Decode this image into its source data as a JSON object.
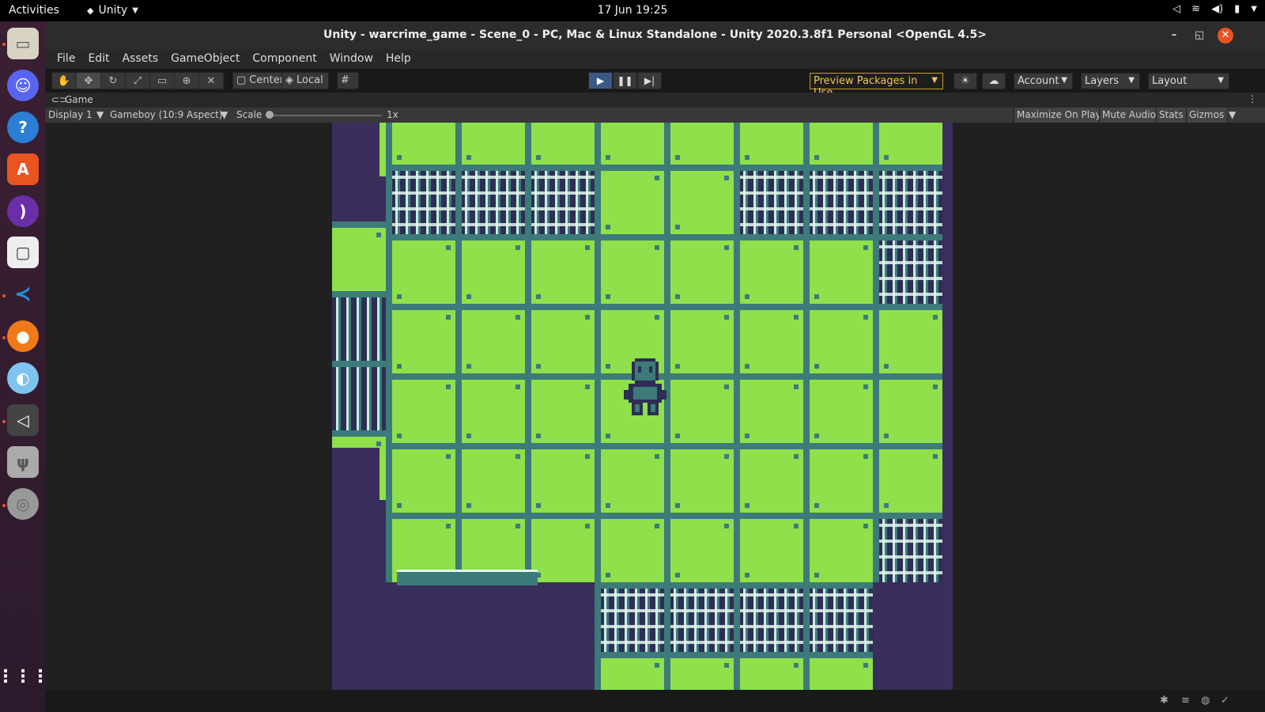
{
  "topbar": {
    "activities": "Activities",
    "app_name": "Unity",
    "clock": "17 Jun  19:25"
  },
  "dock": {
    "items": [
      "files-icon",
      "discord-icon",
      "help-icon",
      "software-icon",
      "podcast-icon",
      "twitch-icon",
      "vscode-icon",
      "firefox-icon",
      "photo-icon",
      "unity-icon",
      "usb-icon",
      "disc-icon"
    ],
    "show_apps_icon": "apps-grid-icon"
  },
  "window": {
    "title": "Unity - warcrime_game - Scene_0 - PC, Mac & Linux Standalone - Unity 2020.3.8f1 Personal <OpenGL 4.5>",
    "menu": [
      "File",
      "Edit",
      "Assets",
      "GameObject",
      "Component",
      "Window",
      "Help"
    ],
    "toolbar": {
      "center": "Center",
      "local": "Local",
      "preview_packages": "Preview Packages in Use",
      "account": "Account",
      "layers": "Layers",
      "layout": "Layout"
    },
    "game_tab": "Game",
    "game_bar": {
      "display": "Display 1",
      "aspect": "Gameboy (10:9 Aspect)",
      "scale_label": "Scale",
      "scale_value": "1x",
      "maximize": "Maximize On Play",
      "mute": "Mute Audio",
      "stats": "Stats",
      "gizmos": "Gizmos"
    }
  },
  "colors": {
    "grass": "#8fe04a",
    "grid": "#3c7b7a",
    "dark": "#3a2e5c",
    "rock": "#2e2d55",
    "highlight": "#e4f6ef",
    "play_active": "#3a5a86",
    "brand": "#e95420"
  }
}
